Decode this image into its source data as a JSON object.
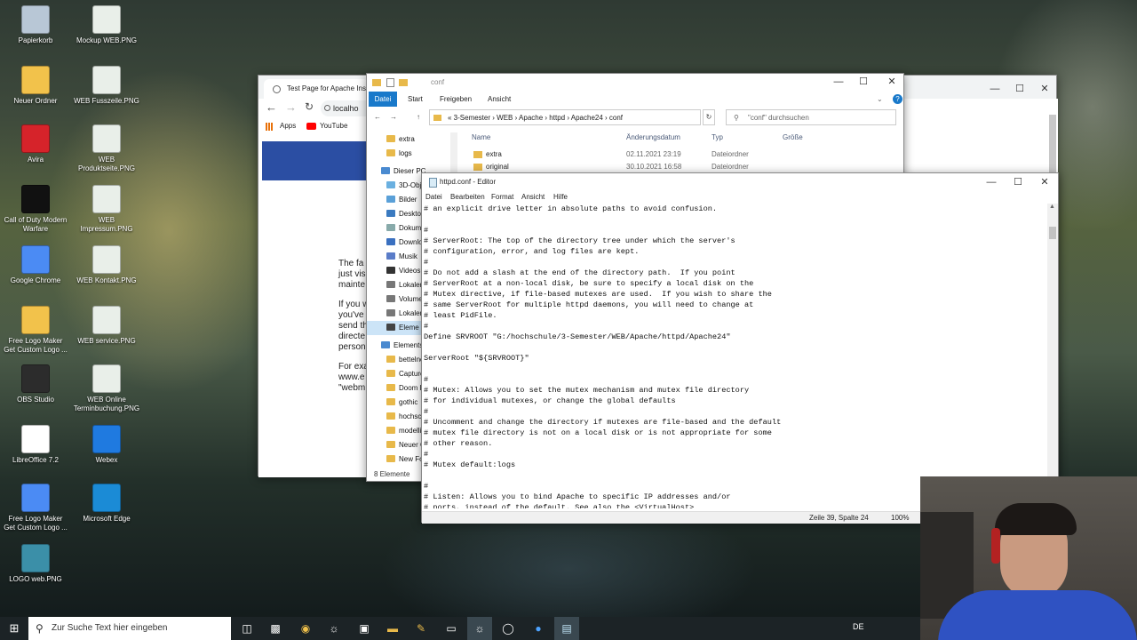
{
  "desktop": {
    "icons": [
      {
        "label": "Papierkorb",
        "color": "#b8c7d6"
      },
      {
        "label": "Mockup WEB.PNG",
        "color": "#e9efe9"
      },
      {
        "label": "Neuer Ordner",
        "color": "#f2c24b"
      },
      {
        "label": "WEB Fusszeile.PNG",
        "color": "#e9efe9"
      },
      {
        "label": "Avira",
        "color": "#d6232a"
      },
      {
        "label": "WEB Produktseite.PNG",
        "color": "#e9efe9"
      },
      {
        "label": "Call of Duty Modern Warfare",
        "color": "#111111"
      },
      {
        "label": "WEB Impressum.PNG",
        "color": "#e9efe9"
      },
      {
        "label": "Google Chrome",
        "color": "#4b8bf4"
      },
      {
        "label": "WEB Kontakt.PNG",
        "color": "#e9efe9"
      },
      {
        "label": "Free Logo Maker Get Custom Logo ...",
        "color": "#f2c24b"
      },
      {
        "label": "WEB service.PNG",
        "color": "#e9efe9"
      },
      {
        "label": "OBS Studio",
        "color": "#2c2c2c"
      },
      {
        "label": "WEB Online Terminbuchung.PNG",
        "color": "#e9efe9"
      },
      {
        "label": "LibreOffice 7.2",
        "color": "#ffffff"
      },
      {
        "label": "Webex",
        "color": "#1f7ae0"
      },
      {
        "label": "Free Logo Maker Get Custom Logo ...",
        "color": "#4b8bf4"
      },
      {
        "label": "Microsoft Edge",
        "color": "#1b8bd6"
      },
      {
        "label": "LOGO web.PNG",
        "color": "#3b8fa8"
      }
    ]
  },
  "browser": {
    "tab_title": "Test Page for Apache Insta",
    "address": "localho",
    "bookmarks": [
      "Apps",
      "YouTube"
    ],
    "body_lines": [
      "The fa",
      "just vis",
      "mainte",
      "If you w",
      "you've",
      "send th",
      "directe",
      "person",
      "For exa",
      "www.e",
      "\"webm"
    ]
  },
  "explorer": {
    "title": "conf",
    "ribbon_tabs": [
      "Datei",
      "Start",
      "Freigeben",
      "Ansicht"
    ],
    "path": [
      "3-Semester",
      "WEB",
      "Apache",
      "httpd",
      "Apache24",
      "conf"
    ],
    "search_placeholder": "\"conf\" durchsuchen",
    "columns": [
      "Name",
      "Änderungsdatum",
      "Typ",
      "Größe"
    ],
    "files": [
      {
        "name": "extra",
        "date": "02.11.2021 23:19",
        "type": "Dateiordner"
      },
      {
        "name": "original",
        "date": "30.10.2021 16:58",
        "type": "Dateiordner"
      }
    ],
    "tree": [
      "extra",
      "logs",
      "Dieser PC",
      "3D-Obje",
      "Bilder",
      "Desktop",
      "Dokume",
      "Downlo",
      "Musik",
      "Videos",
      "Lokaler",
      "Volume",
      "Lokaler",
      "Eleme",
      "Elements",
      "bettelne",
      "Capture",
      "Doom Et",
      "gothic",
      "hochsch",
      "modelli",
      "Neuer O",
      "New Fo"
    ],
    "status": "8 Elemente"
  },
  "editor": {
    "title": "httpd.conf - Editor",
    "menu": [
      "Datei",
      "Bearbeiten",
      "Format",
      "Ansicht",
      "Hilfe"
    ],
    "lines": [
      "# an explicit drive letter in absolute paths to avoid confusion.",
      "",
      "#",
      "# ServerRoot: The top of the directory tree under which the server's",
      "# configuration, error, and log files are kept.",
      "#",
      "# Do not add a slash at the end of the directory path.  If you point",
      "# ServerRoot at a non-local disk, be sure to specify a local disk on the",
      "# Mutex directive, if file-based mutexes are used.  If you wish to share the",
      "# same ServerRoot for multiple httpd daemons, you will need to change at",
      "# least PidFile.",
      "#",
      "Define SRVROOT \"G:/hochschule/3-Semester/WEB/Apache/httpd/Apache24\"",
      "",
      "ServerRoot \"${SRVROOT}\"",
      "",
      "#",
      "# Mutex: Allows you to set the mutex mechanism and mutex file directory",
      "# for individual mutexes, or change the global defaults",
      "#",
      "# Uncomment and change the directory if mutexes are file-based and the default",
      "# mutex file directory is not on a local disk or is not appropriate for some",
      "# other reason.",
      "#",
      "# Mutex default:logs",
      "",
      "#",
      "# Listen: Allows you to bind Apache to specific IP addresses and/or",
      "# ports, instead of the default. See also the <VirtualHost>"
    ],
    "status_position": "Zeile 39, Spalte 24",
    "status_zoom": "100%"
  },
  "taskbar": {
    "search_placeholder": "Zur Suche Text hier eingeben",
    "language": "DE"
  }
}
